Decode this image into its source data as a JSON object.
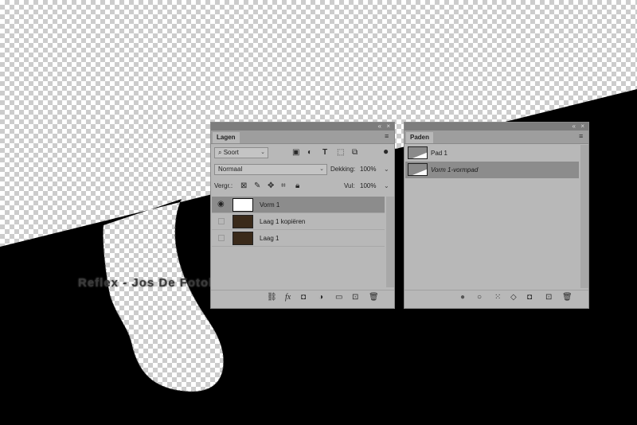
{
  "watermark": "Reflex - Jos De Fotoblogger",
  "layers_panel": {
    "tab": "Lagen",
    "collapse": "«",
    "close": "×",
    "filter_label": "Soort",
    "blend_mode": "Normaal",
    "opacity_label": "Dekking:",
    "opacity_value": "100%",
    "lock_label": "Vergr.:",
    "fill_label": "Vul:",
    "fill_value": "100%",
    "layers": [
      {
        "name": "Vorm 1",
        "visible": true,
        "active": true,
        "type": "shape"
      },
      {
        "name": "Laag 1 kopiëren",
        "visible": false,
        "active": false,
        "type": "image"
      },
      {
        "name": "Laag 1",
        "visible": false,
        "active": false,
        "type": "image"
      }
    ]
  },
  "paths_panel": {
    "tab": "Paden",
    "collapse": "«",
    "close": "×",
    "paths": [
      {
        "name": "Pad 1",
        "active": false
      },
      {
        "name": "Vorm 1-vormpad",
        "active": true
      }
    ]
  },
  "icons": {
    "eye": "eye-icon",
    "link": "link-layers-icon",
    "fx": "fx",
    "mask": "add-mask-icon",
    "adjustment": "adjustment-layer-icon",
    "group": "group-folder-icon",
    "new": "new-layer-icon",
    "delete": "trash-icon"
  }
}
